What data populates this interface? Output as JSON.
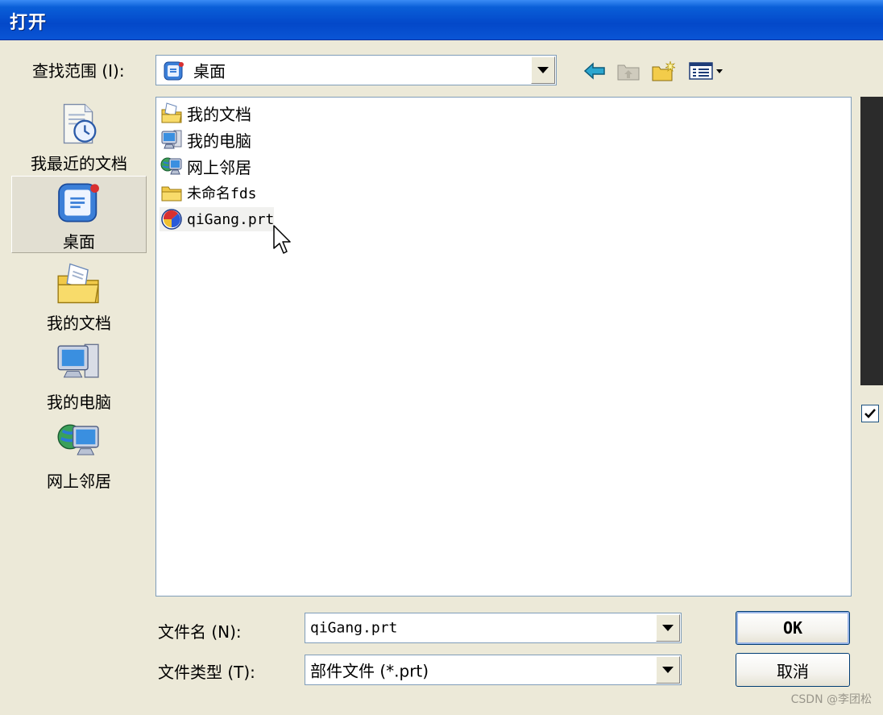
{
  "window": {
    "title": "打开"
  },
  "lookin": {
    "label": "查找范围 (I):",
    "value": "桌面"
  },
  "toolbar": {
    "back_icon": "back-arrow-icon",
    "up_icon": "up-folder-icon",
    "new_folder_icon": "new-folder-icon",
    "view_icon": "view-menu-icon"
  },
  "places": [
    {
      "label": "我最近的文档",
      "icon": "recent-documents-icon"
    },
    {
      "label": "桌面",
      "icon": "desktop-icon",
      "selected": true
    },
    {
      "label": "我的文档",
      "icon": "my-documents-icon"
    },
    {
      "label": "我的电脑",
      "icon": "my-computer-icon"
    },
    {
      "label": "网上邻居",
      "icon": "network-places-icon"
    }
  ],
  "files": [
    {
      "name": "我的文档",
      "icon": "my-documents-icon"
    },
    {
      "name": "我的电脑",
      "icon": "my-computer-icon"
    },
    {
      "name": "网上邻居",
      "icon": "network-places-icon"
    },
    {
      "name": "未命名fds",
      "icon": "folder-icon"
    },
    {
      "name": "qiGang.prt",
      "icon": "part-file-icon"
    }
  ],
  "filename": {
    "label": "文件名 (N):",
    "value": "qiGang.prt"
  },
  "filetype": {
    "label": "文件类型 (T):",
    "value": "部件文件 (*.prt)"
  },
  "buttons": {
    "ok": "OK",
    "cancel": "取消"
  },
  "watermark": "CSDN @李团松",
  "colors": {
    "titlebar": "#0348c9",
    "dialog_bg": "#ece9d8",
    "list_bg": "#ffffff"
  }
}
